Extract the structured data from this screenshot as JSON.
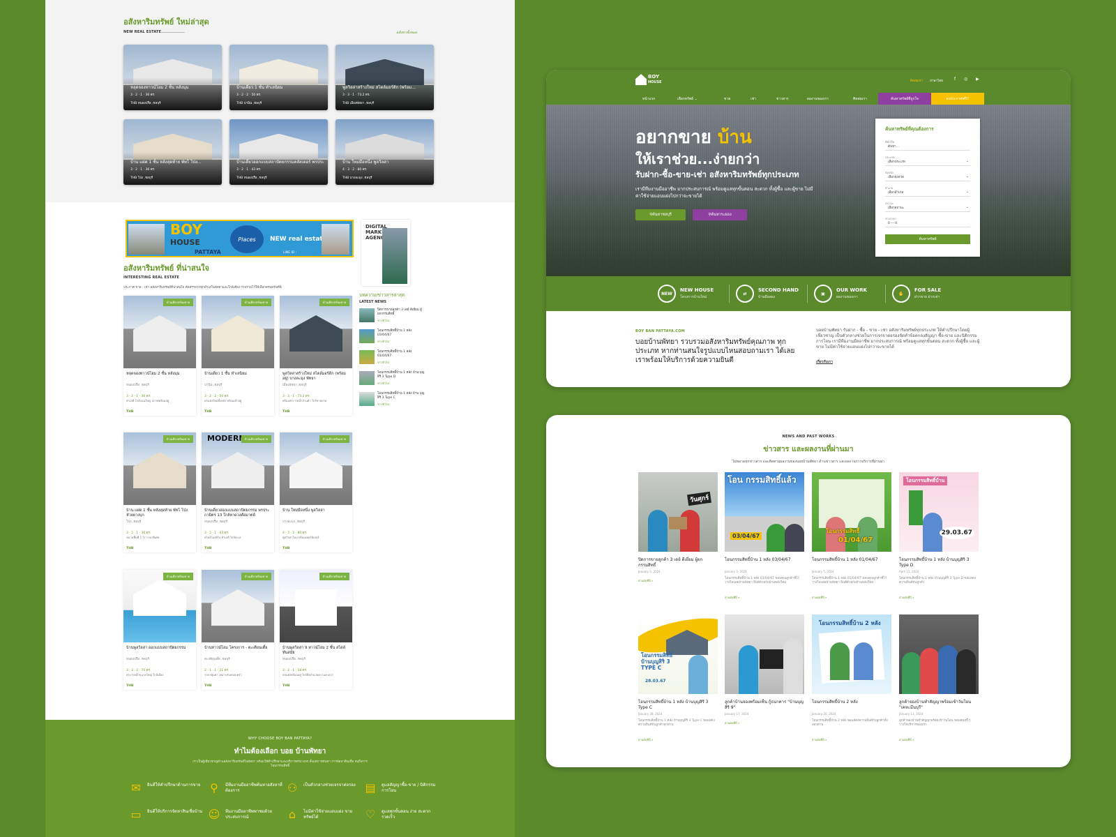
{
  "colors": {
    "brand_green": "#6a9a2c",
    "dark_green": "#5b8a2d",
    "accent_yellow": "#f5c200",
    "accent_purple": "#8e3fa0"
  },
  "new_listings": {
    "title": "อสังหาริมทรัพย์ ใหม่ล่าสุด",
    "subtitle": "NEW REAL ESTATE",
    "view_all": "อสังหาทั้งหมด",
    "cards": [
      {
        "title": "หลุดจองทาวน์โฮม 2 ชั้น หลังมุม",
        "meta": "3 · 2 · 1 · 36 ตร.",
        "loc": "THB   หนองปรือ ,ชลบุรี"
      },
      {
        "title": "บ้านเดี่ยว 1 ชั้น ทำเลนิยม",
        "meta": "3 · 2 · 2 · 50 ตร.",
        "loc": "THB   ปานิน ,ชลบุรี"
      },
      {
        "title": "พูลวิลล่าสร้างใหม่ สไตล์มอร์ดิก (พร้อม...",
        "meta": "3 · 3 · 1 · 73.2 ตร.",
        "loc": "THB   เมืองพัทยา ,ชลบุรี"
      },
      {
        "title": "บ้าน แฝด 1 ชั้น หลังสุดท้าย พัทโ โป่ง...",
        "meta": "3 · 2 · 1 · 36 ตร.",
        "loc": "THB   โป่ง ,ชลบุรี"
      },
      {
        "title": "บ้านเดี่ยวออกแบบสถาปัตยกรรมคลัสเตอร์ พรประกา...",
        "meta": "3 · 2 · 1 · 43 ตร.",
        "loc": "THB   หนองปรือ ,ชลบุรี"
      },
      {
        "title": "บ้าน ใหม่มือหนึ่ง พูลวิลล่า",
        "meta": "4 · 3 · 2 · 80 ตร.",
        "loc": "THB   บางละมุง ,ชลบุรี"
      }
    ]
  },
  "banner": {
    "boy": "BOY",
    "house": "HOUSE",
    "pattaya": "PATTAYA",
    "places": "Places",
    "new_re": "NEW real estate",
    "line_id": "LINE ID :"
  },
  "agency": {
    "title": "DIGITAL MARKETING AGENCY"
  },
  "interesting": {
    "title": "อสังหาริมทรัพย์ ที่น่าสนใจ",
    "subtitle": "INTERESTING REAL ESTATE",
    "desc": "ประกาศ ขาย - เช่า อสังหาริมทรัพย์ที่น่าสนใจ คัดสรรจากทุกทำเลในพัทยาและใกล้เคียง รวบรวมไว้ให้เลือกครบครันที่นี่",
    "tag": "บ้านเดี่ยวพร้อมขาย",
    "cards": [
      {
        "title": "หลุดจองทาวน์โฮม 2 ชั้น หลังมุม",
        "loc": "หนองปรือ ,ชลบุรี",
        "meta": "3 · 2 · 1 · 36 ตร.",
        "desc": "ทำเลดี ใกล้ถนนใหญ่ สภาพพร้อมอยู่",
        "thb": "THB"
      },
      {
        "title": "บ้านเดี่ยว 1 ชั้น ทำเลนิยม",
        "loc": "ปานิน ,ชลบุรี",
        "meta": "3 · 2 · 2 · 50 ตร.",
        "desc": "ตกแต่งใหม่ทั้งหลัง พร้อมเข้าอยู่",
        "thb": "THB"
      },
      {
        "title": "พูลวิลล่าสร้างใหม่ สไตล์มอร์ดิก (พร้อมอยู่) บางละมุง พัทยา",
        "loc": "เมืองพัทยา ,ชลบุรี",
        "meta": "3 · 3 · 1 · 73.2 ตร.",
        "desc": "พร้อมสระว่ายน้ำส่วนตัว ใกล้ชายหาด",
        "thb": "THB"
      },
      {
        "title": "บ้าน แฝด 1 ชั้น หลังสุดท้าย พัทโ โป่ง ห้วยยางบุก",
        "loc": "โป่ง ,ชลบุรี",
        "meta": "3 · 2 · 1 · 36 ตร.",
        "desc": "ขนาดพื้นที่ 1 ไร่ ราคาพิเศษ",
        "thb": "THB"
      },
      {
        "title": "บ้านเดี่ยวออกแบบสถาปัตยกรรม พรประกามิตร 13 ใกล้หาดวงศ์อมาตย์",
        "loc": "หนองปรือ ,ชลบุรี",
        "meta": "3 · 2 · 1 · 43 ตร.",
        "desc": "สไตล์โมเดิร์น ทำเลดี ใกล้ทะเล",
        "thb": "THB"
      },
      {
        "title": "บ้าน ใหม่มือหนึ่ง พูลวิลล่า",
        "loc": "บางละมุง ,ชลบุรี",
        "meta": "4 · 3 · 2 · 80 ตร.",
        "desc": "พูลวิลล่าใหม่ พร้อมเฟอร์นิเจอร์",
        "thb": "THB"
      },
      {
        "title": "บ้านพูลวิลล่า ออกแบบสถาปัตยกรรม",
        "loc": "หนองปรือ ,ชลบุรี",
        "meta": "3 · 3 · 2 · 70 ตร.",
        "desc": "สระว่ายน้ำขนาดใหญ่ ใกล้เมือง",
        "thb": "THB"
      },
      {
        "title": "บ้านทาวน์โฮม โครงการ - ตะเคียนเตี้ย",
        "loc": "ตะเคียนเตี้ย ,ชลบุรี",
        "meta": "2 · 1 · 1 · 21 ตร.",
        "desc": "ราคาคุ้มค่า เหมาะกับครอบครัว",
        "thb": "THB"
      },
      {
        "title": "บ้านพูลวิลล่า 9 ทาวน์โฮม 2 ชั้น สไตล์ทันสมัย",
        "loc": "หนองปรือ ,ชลบุรี",
        "meta": "3 · 2 · 1 · 18 ตร.",
        "desc": "ตกแต่งพร้อมอยู่ ใกล้สิ่งอำนวยความสะดวก",
        "thb": "THB"
      }
    ]
  },
  "latest_news": {
    "title": "บทความ/ข่าวสารล่าสุด",
    "subtitle": "LATEST NEWS",
    "items": [
      {
        "title": "ปิดการขายลูกค้า 3 เดย์ ดีเยี่ยม ผู้ยกกรรมสิทธิ์",
        "date": "ข่าวทั่วไป"
      },
      {
        "title": "โอนกรรมสิทธิ์บ้าน 1 หลัง 03/04/67",
        "date": "ข่าวทั่วไป"
      },
      {
        "title": "โอนกรรมสิทธิ์บ้าน 1 หลัง 01/04/67",
        "date": "ข่าวทั่วไป"
      },
      {
        "title": "โอนกรรมสิทธิ์บ้าน 1 หลัง บ้าน บุญสิริ 3 Type D",
        "date": "ข่าวทั่วไป"
      },
      {
        "title": "โอนกรรมสิทธิ์บ้าน 1 หลัง บ้าน บุญสิริ 3 Type C",
        "date": "ข่าวทั่วไป"
      }
    ]
  },
  "why": {
    "subtitle": "WHY CHOOSE BOY BAN PATTAYA?",
    "title": "ทำไมต้องเลือก บอย บ้านพัทยา",
    "desc": "เราเป็นผู้เชี่ยวชาญด้านอสังหาริมทรัพย์ในพัทยา พร้อมให้คำปรึกษาและบริการครบวงจร ตั้งแต่การค้นหา การจัดหาสินเชื่อ จนถึงการโอนกรรมสิทธิ์",
    "features": [
      {
        "icon": "chat-icon",
        "text": "ยินดีให้คำปรึกษาด้านการขาย"
      },
      {
        "icon": "search-icon",
        "text": "มีทีมงานมืออาชีพค้นหาอสังหาที่ต้องการ"
      },
      {
        "icon": "people-icon",
        "text": "เป็นตัวกลางช่วยเจรจาต่อรอง"
      },
      {
        "icon": "document-icon",
        "text": "ดูแลสัญญาซื้อ-ขาย / นิติกรรมการโอน"
      },
      {
        "icon": "card-icon",
        "text": "ยินดีให้บริการจัดหาสินเชื่อบ้าน"
      },
      {
        "icon": "agent-icon",
        "text": "ทีมงานมืออาชีพพาชมด้วยประสบการณ์"
      },
      {
        "icon": "tag-icon",
        "text": "ไม่มีค่าใช้จ่ายแอบแฝง ขายทรัพย์ได้"
      },
      {
        "icon": "handshake-icon",
        "text": "ดูแลทุกขั้นตอน ง่าย สะดวก รวดเร็ว"
      }
    ]
  },
  "header": {
    "logo_top": "BOY",
    "logo_bottom": "HOUSE",
    "contact": "ติดต่อเรา",
    "lang": "ภาษาไทย",
    "social": "f ◎ ▶",
    "nav": [
      "หน้าแรก",
      "เลือกทรัพย์ ⌄",
      "ขาย",
      "เช่า",
      "ข่าวสาร",
      "ผลงานของเรา",
      "ติดต่อเรา"
    ],
    "btn_search": "ค้นหาทรัพย์ที่ถูกใจ",
    "btn_post": "ลงประกาศฟรี!!"
  },
  "hero": {
    "h1a": "อยากขาย ",
    "h1b": "บ้าน",
    "h2": "ให้เราช่วย...ง่ายกว่า",
    "h3": "รับฝาก-ซื้อ-ขาย-เช่า อสังหาริมทรัพย์ทุกประเภท",
    "desc": "เรามีทีมงานมืออาชีพ มากประสบการณ์ พร้อมดูแลทุกขั้นตอน สะดวก ทั้งผู้ซื้อ และผู้ขาย ไม่มีค่าใช้จ่ายแอบแฝงไปกว่าจะขายได้",
    "btn1": "ค้นหาชลบุรี",
    "btn2": "ค้นหาระยอง"
  },
  "search_form": {
    "title": "ค้นหาทรัพย์ที่คุณต้องการ",
    "fields": [
      {
        "label": "คีย์เวิร์ด",
        "value": "ค้นหา..."
      },
      {
        "label": "ประเภท",
        "value": "เลือกประเภท"
      },
      {
        "label": "จังหวัด",
        "value": "เลือกจังหวัด"
      },
      {
        "label": "อำเภอ",
        "value": "เลือกอำเภอ"
      },
      {
        "label": "สถานะ",
        "value": "เลือกสถานะ"
      },
      {
        "label": "ช่วงราคา",
        "value": "0  ―  0"
      }
    ],
    "submit": "ค้นหาทรัพย์"
  },
  "features": [
    {
      "icon": "NEW",
      "title": "NEW HOUSE",
      "sub": "โครงการบ้านใหม่"
    },
    {
      "icon": "⇄",
      "title": "SECOND HAND",
      "sub": "บ้านมือสอง"
    },
    {
      "icon": "▣",
      "title": "OUR WORK",
      "sub": "ผลงานของเรา"
    },
    {
      "icon": "✋",
      "title": "FOR SALE",
      "sub": "ฝากขาย ฝากเช่า"
    }
  ],
  "about": {
    "label": "BOY BAN PATTAYA.COM",
    "heading": "บอยบ้านพัทยา รวบรวมอสังหาริมทรัพย์คุณภาพ ทุกประเภท หากท่านสนใจรูปแบบไหนสอบถามเรา ได้เลย เราพร้อมให้บริการด้วยความยินดี",
    "para": "บอยบ้านพัทยา รับฝาก - ซื้อ - ขาย - เช่า อสังหาริมทรัพย์ทุกประเภท ให้คำปรึกษาโดยผู้เชี่ยวชาญ เป็นตัวกลางช่วยในการเจรจาต่อรองจัดทำข้อตกลงสัญญา ซื้อ-ขาย และนิติกรรมการโอน เรามีทีมงานมืออาชีพ มากประสบการณ์ พร้อมดูแลทุกขั้นตอน สะดวก ทั้งผู้ซื้อ และผู้ขาย ไม่มีค่าใช้จ่ายแอบแฝงไปกว่าจะขายได้",
    "more": "เกี่ยวกับเรา"
  },
  "news": {
    "subtitle": "NEWS AND PAST WORKS",
    "title": "ข่าวสาร และผลงานที่ผ่านมา",
    "desc": "ไม่พลาดทุกข่าวสาร และติดตามผลงานของบอยบ้านพัทยา ด้านข่าวสาร และผลงานการบริการที่ผ่านมา",
    "items": [
      {
        "title": "ปิดการขายลูกค้า 3 เดย์ ดีเยี่ยม ผู้ยกกรรมสิทธิ์",
        "date": "January 5, 2024",
        "desc": "",
        "more": "อ่านต่อที่นี่ »"
      },
      {
        "title": "โอนกรรมสิทธิ์บ้าน 1 หลัง 03/04/67",
        "date": "January 5, 2024",
        "desc": "โอนกรรมสิทธิ์บ้าน 1 หลัง 03/04/67 ขอบคุณลูกค้าที่ไว้วางใจบอยบ้านพัทยา ยินดีด้วยกับบ้านหลังใหม่",
        "more": "อ่านต่อที่นี่ »"
      },
      {
        "title": "โอนกรรมสิทธิ์บ้าน 1 หลัง 01/04/67",
        "date": "January 5, 2024",
        "desc": "โอนกรรมสิทธิ์บ้าน 1 หลัง 01/04/67 ขอบคุณลูกค้าที่ไว้วางใจบอยบ้านพัทยา ยินดีด้วยกับบ้านหลังใหม่",
        "more": "อ่านต่อที่นี่ »"
      },
      {
        "title": "โอนกรรมสิทธิ์บ้าน 1 หลัง บ้านบุญสิริ 3 Type D",
        "date": "April 12, 2024",
        "desc": "โอนกรรมสิทธิ์บ้าน 1 หลัง บ้านบุญสิริ 3 Type D ขอแสดงความยินดีกับลูกค้า",
        "more": "อ่านต่อที่นี่ »"
      },
      {
        "title": "โอนกรรมสิทธิ์บ้าน 1 หลัง บ้านบุญสิริ 3 Type C",
        "date": "January 28, 2024",
        "desc": "โอนกรรมสิทธิ์บ้าน 1 หลัง บ้านบุญสิริ 3 Type C ขอแสดงความยินดีกับลูกค้าทุกท่าน",
        "more": "อ่านต่อที่นี่ »"
      },
      {
        "title": "ลูกค้าบ้านจองพร้อมเซ็น กู้ธนาคาร \"บ้านบุญสิริ 9\"",
        "date": "January 17, 2024",
        "desc": "",
        "more": "อ่านต่อที่นี่ »"
      },
      {
        "title": "โอนกรรมสิทธิ์บ้าน 2 หลัง",
        "date": "January 20, 2024",
        "desc": "โอนกรรมสิทธิ์บ้าน 2 หลัง ขอแสดงความยินดีกับลูกค้าทั้งสองท่าน",
        "more": "อ่านต่อที่นี่ »"
      },
      {
        "title": "ลูกค้าจองบ้านทำสัญญาพร้อมเข้าวันโอน \"เคหะมีนบุรี\"",
        "date": "January 13, 2024",
        "desc": "ลูกค้าจองบ้านทำสัญญาพร้อมเข้าวันโอน ขอบคุณที่ไว้วางใจบริการของเรา",
        "more": "อ่านต่อที่นี่ »"
      }
    ],
    "badges": [
      "วันศุกร์",
      "โอน กรรมสิทธิ์แล้ว",
      "03/04/67",
      "โอนกรรมสิทธิ์",
      "01/04/67",
      "โอนกรรมสิทธิ์บ้าน",
      "29.03.67",
      "โอนกรรมสิทธิ์ บ้านบุญสิริ 3 TYPE C",
      "28.03.67",
      "โอนกรรมสิทธิ์บ้าน 2 หลัง"
    ]
  }
}
